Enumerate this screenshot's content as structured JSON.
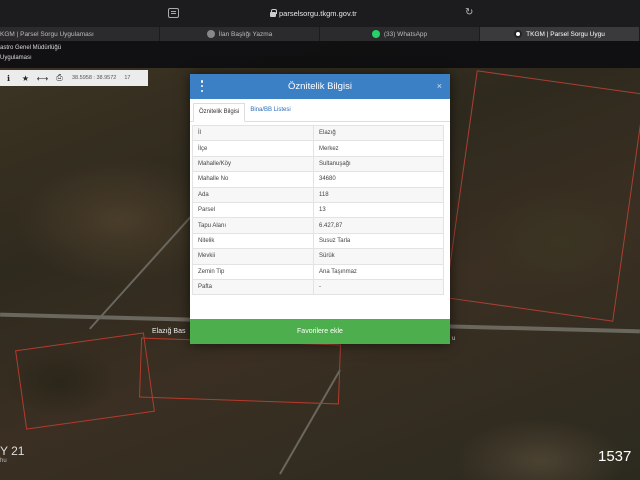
{
  "browser": {
    "url": "parselsorgu.tkgm.gov.tr",
    "tabs": [
      {
        "label": "KGM | Parsel Sorgu Uygulaması",
        "icon": "none"
      },
      {
        "label": "İlan Başlığı Yazma",
        "icon": "page-icon"
      },
      {
        "label": "(33) WhatsApp",
        "icon": "whatsapp-icon"
      },
      {
        "label": "TKGM | Parsel Sorgu Uygu",
        "icon": "tkgm-icon"
      }
    ]
  },
  "header": {
    "line1": "astro Genel Müdürlüğü",
    "line2": "Uygulaması"
  },
  "toolbar": {
    "coords": "38.5958 : 38.9572",
    "zoom": "17"
  },
  "map": {
    "road_label": "Elazığ Bas",
    "road_label_right": "u",
    "watermark_left": "Y 21",
    "watermark_left_small": "hu",
    "watermark_right": "1537"
  },
  "modal": {
    "title": "Öznitelik Bilgisi",
    "close": "×",
    "tabs": [
      "Öznitelik Bilgisi",
      "Bina/BB Listesi"
    ],
    "rows": [
      {
        "key": "İl",
        "value": "Elazığ"
      },
      {
        "key": "İlçe",
        "value": "Merkez"
      },
      {
        "key": "Mahalle/Köy",
        "value": "Sultanuşağı"
      },
      {
        "key": "Mahalle No",
        "value": "34680"
      },
      {
        "key": "Ada",
        "value": "118"
      },
      {
        "key": "Parsel",
        "value": "13"
      },
      {
        "key": "Tapu Alanı",
        "value": "6.427,87"
      },
      {
        "key": "Nitelik",
        "value": "Susuz Tarla"
      },
      {
        "key": "Mevkii",
        "value": "Sürük"
      },
      {
        "key": "Zemin Tip",
        "value": "Ana Taşınmaz"
      },
      {
        "key": "Pafta",
        "value": "-"
      }
    ],
    "favorite_label": "Favorilere ekle"
  },
  "colors": {
    "modal_header": "#3b7fc4",
    "favorite_button": "#4cae4c",
    "parcel_border": "#b33b2e"
  }
}
